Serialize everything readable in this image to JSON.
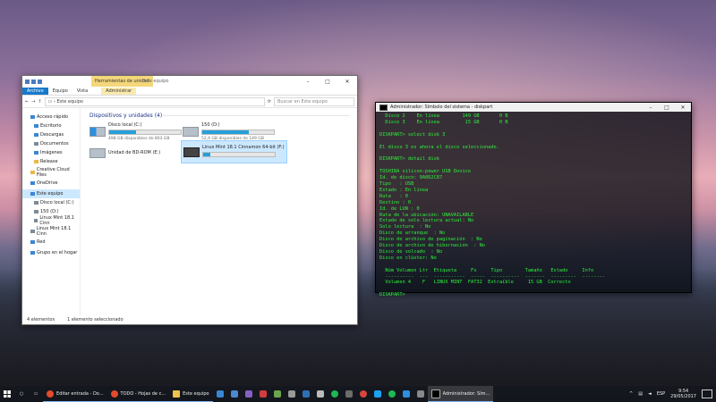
{
  "explorer": {
    "ribbon_context_group": "Herramientas de unidad",
    "window_title": "Este equipo",
    "tabs": [
      "Archivo",
      "Equipo",
      "Vista",
      "Administrar"
    ],
    "address_path": "Este equipo",
    "search_placeholder": "Buscar en Este equipo",
    "nav": {
      "quick_access": "Acceso rápido",
      "escritorio": "Escritorio",
      "descargas": "Descargas",
      "documentos": "Documentos",
      "imagenes": "Imágenes",
      "release": "Release",
      "creative_cloud": "Creative Cloud Files",
      "onedrive": "OneDrive",
      "este_equipo": "Este equipo",
      "disco_local": "Disco local (C:)",
      "drive_150": "150 (D:)",
      "linux_short": "Linux Mint 18.1 Cinn",
      "linux_root": "Linux Mint 18.1 Cinn",
      "red": "Red",
      "grupo_hogar": "Grupo en el hogar"
    },
    "section_title": "Dispositivos y unidades (4)",
    "drives": [
      {
        "name": "Disco local (C:)",
        "free": "498 GB disponibles de 803 GB",
        "fill": 0.38
      },
      {
        "name": "150 (D:)",
        "free": "52,4 GB disponibles de 149 GB",
        "fill": 0.65
      },
      {
        "name": "Unidad de BD-ROM (E:)"
      },
      {
        "name": "Linux Mint 18.1 Cinnamon 64-bit (F:)",
        "fill": 0.1
      }
    ],
    "status_count": "4 elementos",
    "status_selected": "1 elemento seleccionado"
  },
  "cmd": {
    "title": "Administrador: Símbolo del sistema - diskpart",
    "text": "  Disco 2    En línea        149 GB       0 B\n  Disco 3    En línea         15 GB       0 B\n\nDISKPART> select disk 3\n\nEl disco 3 es ahora el disco seleccionado.\n\nDISKPART> detail disk\n\nTOSHIBA silicon-power USB Device\nId. de disco: 9A0D2C87\nTipo   : USB\nEstado : En línea\nRuta   : 0\nDestino : 0\nId. de LUN : 0\nRuta de la ubicación: UNAVAILABLE\nEstado de solo lectura actual: No\nSolo lectura  : No\nDisco de arranque  : No\nDisco de archivo de paginación  : No\nDisco de archivo de hibernación  : No\nDisco de volcado  : No\nDisco en clúster: No\n\n  Núm Volumen Ltr  Etiqueta     Fs     Tipo        Tamaño   Estado     Info\n  ----------  ---  -----------  -----  ----------  -------  ---------  --------\n  Volumen 4    F   LINUX MINT  FAT32  Extraíble     15 GB  Correcto\n\nDISKPART>"
  },
  "taskbar": {
    "apps": [
      {
        "label": "Editar entrada - Do...",
        "color": "#e34a2e"
      },
      {
        "label": "TODO - Hojas de c...",
        "color": "#e34a2e"
      },
      {
        "label": "Este equipo",
        "color": "#f0c24b"
      }
    ],
    "cmd_app": "Administrador: Sím...",
    "lang": "ESP",
    "time": "9:54",
    "date": "29/05/2017"
  }
}
